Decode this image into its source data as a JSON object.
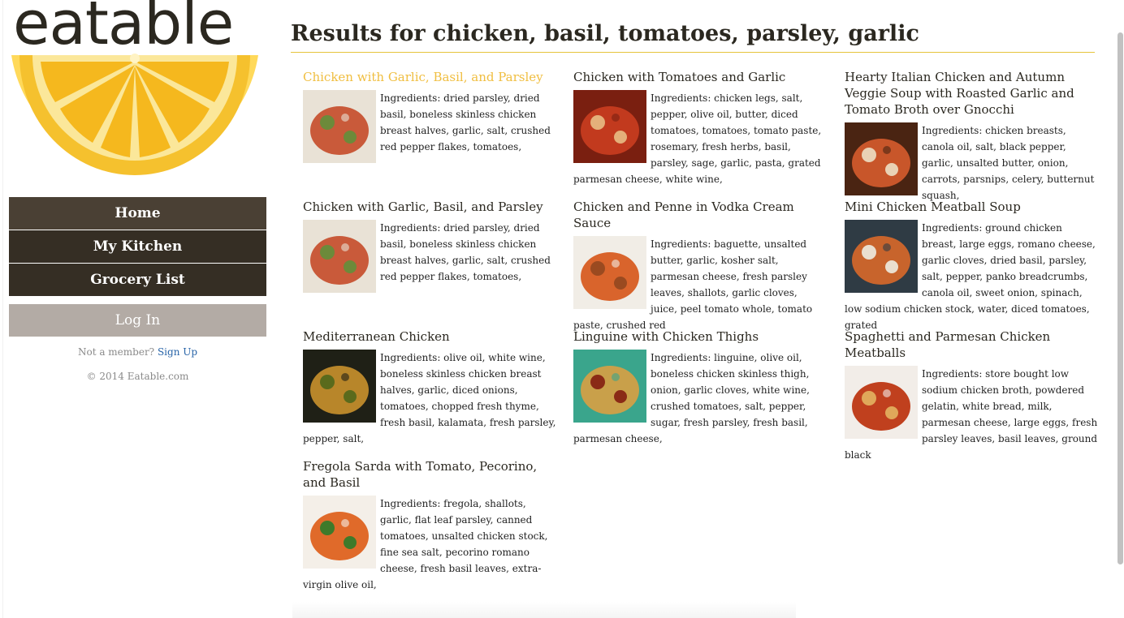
{
  "brand": {
    "name": "eatable",
    "lemon_color": "#f5c12e",
    "rind_color": "#ffd95a"
  },
  "nav": {
    "items": [
      {
        "label": "Home"
      },
      {
        "label": "My Kitchen"
      },
      {
        "label": "Grocery List"
      }
    ],
    "login_label": "Log In",
    "member_prompt": "Not a member?",
    "signup_label": "Sign Up",
    "copyright": "© 2014 Eatable.com"
  },
  "results": {
    "title": "Results for chicken, basil, tomatoes, parsley, garlic",
    "recipes": [
      {
        "title": "Chicken with Garlic, Basil, and Parsley",
        "ingredients": "Ingredients: dried parsley, dried basil, boneless skinless chicken breast halves, garlic, salt, crushed red pepper flakes, tomatoes,",
        "thumb_colors": [
          "#e9e2d6",
          "#c95a3a",
          "#6c8a3a"
        ]
      },
      {
        "title": "Chicken with Tomatoes and Garlic",
        "ingredients": "Ingredients: chicken legs, salt, pepper, olive oil, butter, diced tomatoes, tomatoes, tomato paste, rosemary, fresh herbs, basil, parsley, sage, garlic, pasta, grated parmesan cheese, white wine,",
        "thumb_colors": [
          "#7a1f10",
          "#c23a1e",
          "#e4b07a"
        ]
      },
      {
        "title": "Hearty Italian Chicken and Autumn Veggie Soup with Roasted Garlic and Tomato Broth over Gnocchi",
        "ingredients": "Ingredients: chicken breasts, canola oil, salt, black pepper, garlic, unsalted butter, onion, carrots, parsnips, celery, butternut squash,",
        "thumb_colors": [
          "#4a2412",
          "#c8562a",
          "#e9d2b5"
        ]
      },
      {
        "title": "Chicken with Garlic, Basil, and Parsley",
        "ingredients": "Ingredients: dried parsley, dried basil, boneless skinless chicken breast halves, garlic, salt, crushed red pepper flakes, tomatoes,",
        "thumb_colors": [
          "#e9e2d6",
          "#c95a3a",
          "#6c8a3a"
        ]
      },
      {
        "title": "Chicken and Penne in Vodka Cream Sauce",
        "ingredients": "Ingredients: baguette, unsalted butter, garlic, kosher salt, parmesan cheese, fresh parsley leaves, shallots, garlic cloves, juice, peel tomato whole, tomato paste, crushed red",
        "thumb_colors": [
          "#f1ede6",
          "#d9642c",
          "#9a4a20"
        ]
      },
      {
        "title": "Mini Chicken Meatball Soup",
        "ingredients": "Ingredients: ground chicken breast, large eggs, romano cheese, garlic cloves, dried basil, parsley, salt, pepper, panko breadcrumbs, canola oil, sweet onion, spinach, low sodium chicken stock, water, diced tomatoes, grated",
        "thumb_colors": [
          "#2f3b44",
          "#c8642c",
          "#eadfcf"
        ]
      },
      {
        "title": "Mediterranean Chicken",
        "ingredients": "Ingredients: olive oil, white wine, boneless skinless chicken breast halves, garlic, diced onions, tomatoes, chopped fresh thyme, fresh basil, kalamata, fresh parsley, pepper, salt,",
        "thumb_colors": [
          "#1f2016",
          "#b8862a",
          "#5a6a1c"
        ]
      },
      {
        "title": "Linguine with Chicken Thighs",
        "ingredients": "Ingredients: linguine, olive oil, boneless chicken skinless thigh, onion, garlic cloves, white wine, crushed tomatoes, salt, pepper, sugar, fresh parsley, fresh basil, parmesan cheese,",
        "thumb_colors": [
          "#3aa58c",
          "#c9a04a",
          "#8a2a16"
        ]
      },
      {
        "title": "Spaghetti and Parmesan Chicken Meatballs",
        "ingredients": "Ingredients: store bought low sodium chicken broth, powdered gelatin, white bread, milk, parmesan cheese, large eggs, fresh parsley leaves, basil leaves, ground black",
        "thumb_colors": [
          "#f2ede8",
          "#c0401e",
          "#e0a85a"
        ]
      },
      {
        "title": "Fregola Sarda with Tomato, Pecorino, and Basil",
        "ingredients": "Ingredients: fregola, shallots, garlic, flat leaf parsley, canned tomatoes, unsalted chicken stock, fine sea salt, pecorino romano cheese, fresh basil leaves, extra-virgin olive oil,",
        "thumb_colors": [
          "#f4efe8",
          "#e06a2a",
          "#3f7a2a"
        ]
      }
    ]
  }
}
